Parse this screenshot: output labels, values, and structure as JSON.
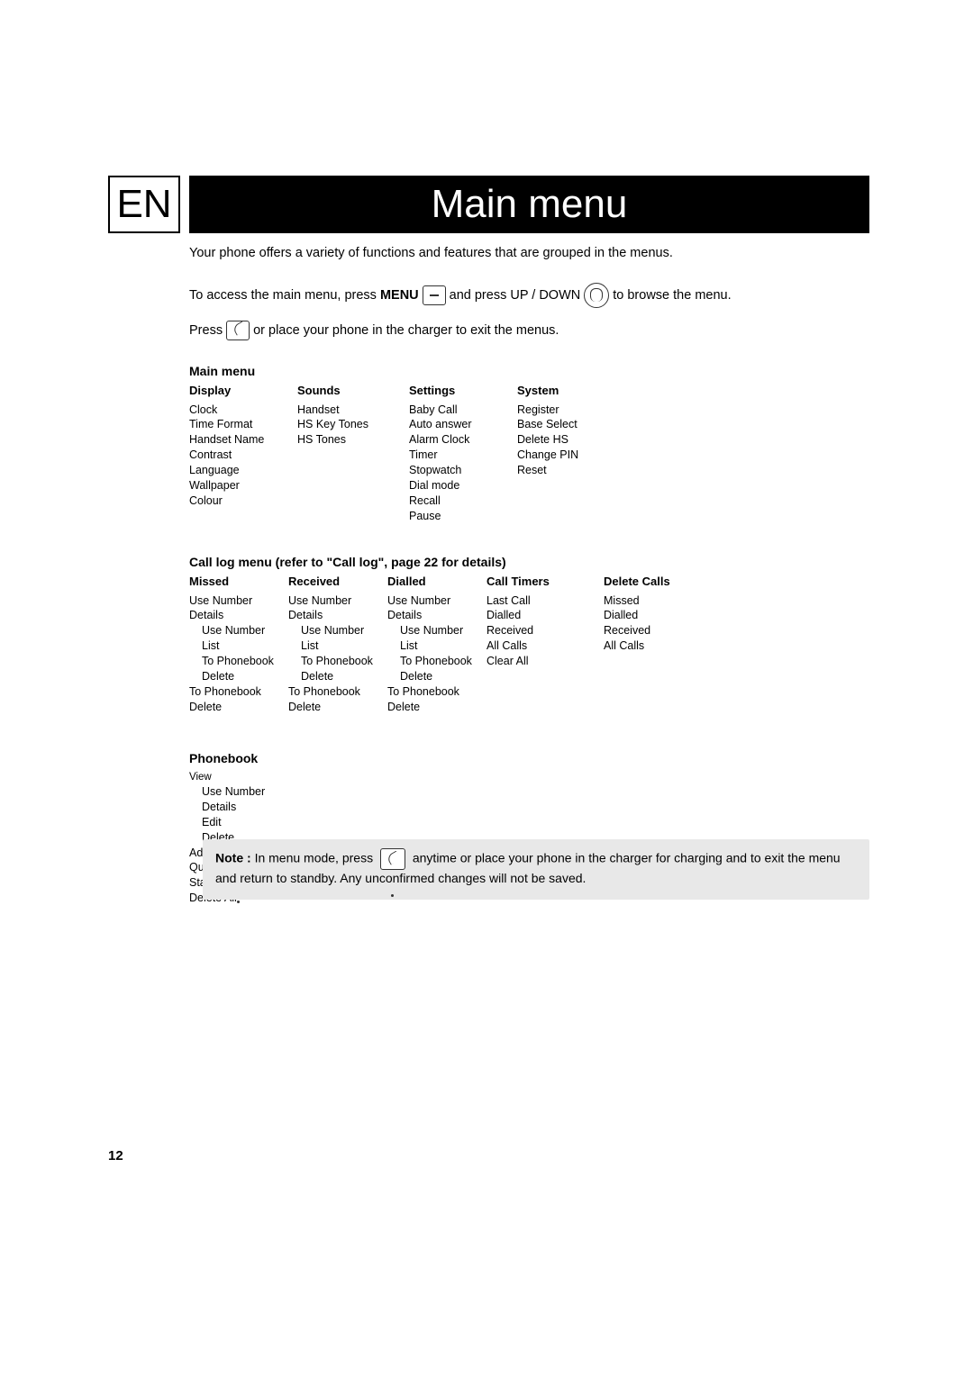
{
  "lang_badge": "EN",
  "page_title": "Main menu",
  "intro": "Your phone offers a variety of functions and features that are grouped in the menus.",
  "access_line": {
    "a": "To access the main menu, press ",
    "menu_word": "MENU",
    "b": " and press  UP / DOWN ",
    "c": " to browse the menu."
  },
  "press_line": {
    "a": "Press ",
    "b": " or place your phone in the charger to exit the menus."
  },
  "main_menu_heading": "Main menu",
  "main_menu_cols": [
    {
      "head": "Display",
      "items": [
        "Clock",
        "Time Format",
        "Handset Name",
        "Contrast",
        "Language",
        "Wallpaper",
        "Colour"
      ]
    },
    {
      "head": "Sounds",
      "items": [
        "Handset",
        "HS Key Tones",
        "HS Tones"
      ]
    },
    {
      "head": "Settings",
      "items": [
        "Baby Call",
        "Auto answer",
        "Alarm Clock",
        "Timer",
        "Stopwatch",
        "Dial mode",
        "Recall",
        "Pause"
      ]
    },
    {
      "head": "System",
      "items": [
        "Register",
        "Base Select",
        "Delete HS",
        "Change PIN",
        "Reset"
      ]
    }
  ],
  "calllog_heading": "Call log menu (refer to \"Call log\", page 22 for details)",
  "calllog_cols": [
    {
      "head": "Missed",
      "items": [
        [
          "Use Number",
          0
        ],
        [
          "Details",
          0
        ],
        [
          "Use Number",
          1
        ],
        [
          "List",
          1
        ],
        [
          "To Phonebook",
          1
        ],
        [
          "Delete",
          1
        ],
        [
          "To Phonebook",
          0
        ],
        [
          "Delete",
          0
        ]
      ]
    },
    {
      "head": "Received",
      "items": [
        [
          "Use Number",
          0
        ],
        [
          "Details",
          0
        ],
        [
          "Use Number",
          1
        ],
        [
          "List",
          1
        ],
        [
          "To Phonebook",
          1
        ],
        [
          "Delete",
          1
        ],
        [
          "To Phonebook",
          0
        ],
        [
          "Delete",
          0
        ]
      ]
    },
    {
      "head": "Dialled",
      "items": [
        [
          "Use Number",
          0
        ],
        [
          "Details",
          0
        ],
        [
          "Use Number",
          1
        ],
        [
          "List",
          1
        ],
        [
          "To Phonebook",
          1
        ],
        [
          "Delete",
          1
        ],
        [
          "To Phonebook",
          0
        ],
        [
          "Delete",
          0
        ]
      ]
    },
    {
      "head": "Call Timers",
      "items": [
        [
          "Last Call",
          0
        ],
        [
          "Dialled",
          0
        ],
        [
          "Received",
          0
        ],
        [
          "All Calls",
          0
        ],
        [
          "Clear All",
          0
        ]
      ]
    },
    {
      "head": "Delete Calls",
      "items": [
        [
          "Missed",
          0
        ],
        [
          "Dialled",
          0
        ],
        [
          "Received",
          0
        ],
        [
          "All Calls",
          0
        ]
      ]
    }
  ],
  "phonebook_heading": "Phonebook",
  "phonebook_items": [
    [
      "View",
      0
    ],
    [
      "Use Number",
      1
    ],
    [
      "Details",
      1
    ],
    [
      "Edit",
      1
    ],
    [
      "Delete",
      1
    ],
    [
      "Add Entry",
      0
    ],
    [
      "Quick Dial",
      0
    ],
    [
      "Status",
      0
    ],
    [
      "Delete All",
      0
    ]
  ],
  "note": {
    "lead": "Note :",
    "a": " In menu mode, press ",
    "b": " anytime or place your phone in the charger for charging and to exit the menu and return to standby. Any unconfirmed changes will not be saved."
  },
  "page_number": "12"
}
